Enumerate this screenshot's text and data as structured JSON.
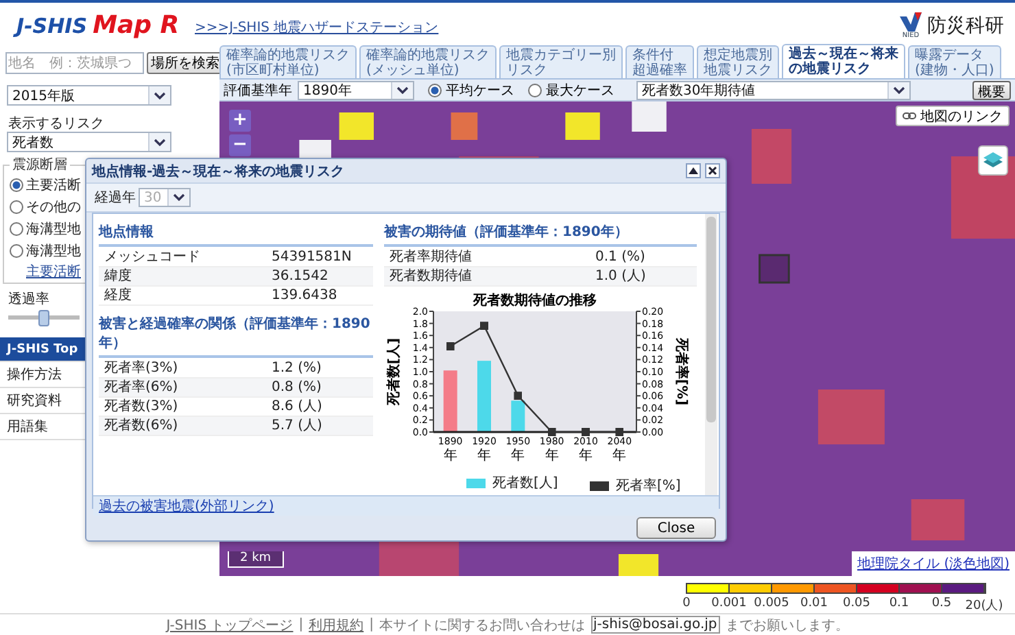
{
  "header": {
    "logo": {
      "main": "J-SHIS",
      "sub": "Map R"
    },
    "site_link": ">>>J-SHIS 地震ハザードステーション",
    "org_logo": {
      "name": "防災科研",
      "abbr": "NIED"
    }
  },
  "sidebar": {
    "search": {
      "placeholder": "地名　例：茨城県つ",
      "button": "場所を検索"
    },
    "version_select": "2015年版",
    "risk_label": "表示するリスク",
    "risk_select": "死者数",
    "source_group": {
      "legend": "震源断層",
      "options": [
        {
          "label": "主要活断",
          "selected": true
        },
        {
          "label": "その他の",
          "selected": false
        },
        {
          "label": "海溝型地",
          "selected": false
        },
        {
          "label": "海溝型地",
          "selected": false
        }
      ],
      "link": "主要活断"
    },
    "opacity": {
      "label": "透過率",
      "level": 0.5
    },
    "nav": [
      {
        "label": "J-SHIS Top",
        "selected": true
      },
      {
        "label": "操作方法",
        "selected": false
      },
      {
        "label": "研究資料",
        "selected": false
      },
      {
        "label": "用語集",
        "selected": false
      }
    ]
  },
  "tabs": [
    {
      "lines": [
        "確率論的地震リスク",
        "(市区町村単位)"
      ],
      "selected": false
    },
    {
      "lines": [
        "確率論的地震リスク",
        "(メッシュ単位)"
      ],
      "selected": false
    },
    {
      "lines": [
        "地震カテゴリー別",
        "リスク"
      ],
      "selected": false
    },
    {
      "lines": [
        "条件付",
        "超過確率"
      ],
      "selected": false
    },
    {
      "lines": [
        "想定地震別",
        "地震リスク"
      ],
      "selected": false
    },
    {
      "lines": [
        "過去～現在～将来",
        "の地震リスク"
      ],
      "selected": true
    },
    {
      "lines": [
        "曝露データ",
        "(建物・人口)"
      ],
      "selected": false
    }
  ],
  "map_toolbar": {
    "year_label": "評価基準年",
    "year_select": "1890年",
    "cases": [
      {
        "label": "平均ケース",
        "selected": true
      },
      {
        "label": "最大ケース",
        "selected": false
      }
    ],
    "index_select": "死者数30年期待値",
    "overview_button": "概要"
  },
  "map": {
    "zoom_in": "+",
    "zoom_out": "−",
    "link_button": "地図のリンク",
    "scale": "2 km",
    "attribution": "地理院タイル (淡色地図)"
  },
  "legend": {
    "segments": [
      {
        "color": "#ffff00"
      },
      {
        "color": "#ffcc00"
      },
      {
        "color": "#ff9900"
      },
      {
        "color": "#ee5522"
      },
      {
        "color": "#d40020"
      },
      {
        "color": "#a01050"
      },
      {
        "color": "#5a1a80"
      }
    ],
    "ticks": [
      "0",
      "0.001",
      "0.005",
      "0.01",
      "0.05",
      "0.1",
      "0.5",
      "20(人)"
    ]
  },
  "dialog": {
    "title": "地点情報-過去～現在～将来の地震リスク",
    "years_label": "経過年",
    "years_select": {
      "value": "30",
      "disabled": true
    },
    "point_info": {
      "heading": "地点情報",
      "rows": [
        {
          "label": "メッシュコード",
          "value": "54391581N"
        },
        {
          "label": "緯度",
          "value": "36.1542"
        },
        {
          "label": "経度",
          "value": "139.6438"
        }
      ]
    },
    "probability": {
      "heading": "被害と経過確率の関係（評価基準年：1890年）",
      "rows": [
        {
          "label": "死者率(3%)",
          "value": "1.2 (%)"
        },
        {
          "label": "死者率(6%)",
          "value": "0.8 (%)"
        },
        {
          "label": "死者数(3%)",
          "value": "8.6 (人)"
        },
        {
          "label": "死者数(6%)",
          "value": "5.7 (人)"
        }
      ]
    },
    "expected": {
      "heading": "被害の期待値（評価基準年：1890年）",
      "rows": [
        {
          "label": "死者率期待値",
          "value": "0.1 (%)"
        },
        {
          "label": "死者数期待値",
          "value": "1.0 (人)"
        }
      ],
      "charts": [
        {
          "chart_data": {
            "type": "bar",
            "title": "死者数期待値の推移",
            "categories": [
              "1890年",
              "1920年",
              "1950年",
              "1980年",
              "2010年",
              "2040年"
            ],
            "ylabel": "死者数[人]",
            "ylim": [
              0,
              2
            ],
            "legend": "bottom",
            "yticks": [
              {
                "value": 0,
                "label": "0.0"
              },
              {
                "value": 0.2,
                "label": "0.2"
              },
              {
                "value": 0.4,
                "label": "0.4"
              },
              {
                "value": 0.6,
                "label": "0.6"
              },
              {
                "value": 0.8,
                "label": "0.8"
              },
              {
                "value": 1,
                "label": "1.0"
              },
              {
                "value": 1.2,
                "label": "1.2"
              },
              {
                "value": 1.4,
                "label": "1.4"
              },
              {
                "value": 1.6,
                "label": "1.6"
              },
              {
                "value": 1.8,
                "label": "1.8"
              },
              {
                "value": 2,
                "label": "2.0"
              }
            ],
            "series": [
              {
                "color": "#f47c88",
                "values": [
                  1.02,
                  null,
                  null,
                  null,
                  null,
                  null
                ]
              },
              {
                "name": "死者数[人]",
                "color": "#4dd9ea",
                "values": [
                  null,
                  1.18,
                  0.52,
                  0,
                  0,
                  0
                ]
              }
            ]
          }
        },
        {
          "chart_data": {
            "type": "line",
            "ylabel": "死者率[%]",
            "ylim": [
              0,
              0.2
            ],
            "legend": "bottom",
            "yticks": [
              {
                "value": 0,
                "label": "0.00"
              },
              {
                "value": 0.02,
                "label": "0.02"
              },
              {
                "value": 0.04,
                "label": "0.04"
              },
              {
                "value": 0.06,
                "label": "0.06"
              },
              {
                "value": 0.08,
                "label": "0.08"
              },
              {
                "value": 0.1,
                "label": "0.10"
              },
              {
                "value": 0.12,
                "label": "0.12"
              },
              {
                "value": 0.14,
                "label": "0.14"
              },
              {
                "value": 0.16,
                "label": "0.16"
              },
              {
                "value": 0.18,
                "label": "0.18"
              },
              {
                "value": 0.2,
                "label": "0.20"
              }
            ],
            "series": [
              {
                "name": "死者率[%]",
                "color": "#333333",
                "values": [
                  0.142,
                  0.176,
                  0.06,
                  0,
                  0,
                  0
                ]
              }
            ]
          }
        }
      ]
    },
    "external_link": "過去の被害地震(外部リンク)",
    "close_button": "Close"
  },
  "footer": {
    "links": [
      "J-SHIS トップページ",
      "利用規約"
    ],
    "separator": "|",
    "text_before": "本サイトに関するお問い合わせは",
    "email": "j-shis@bosai.go.jp",
    "text_after": "までお願いします。"
  }
}
